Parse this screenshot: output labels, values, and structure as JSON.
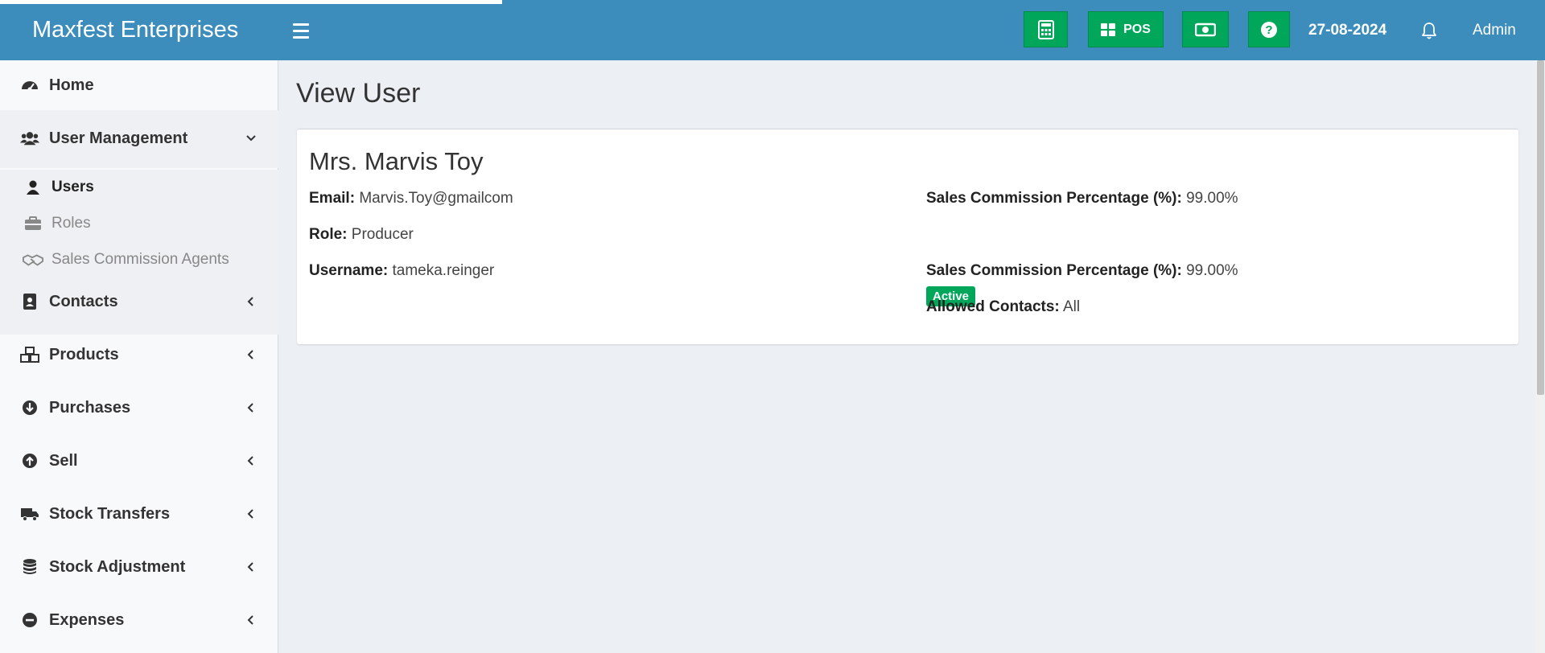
{
  "header": {
    "brand": "Maxfest Enterprises",
    "pos_label": "POS",
    "date": "27-08-2024",
    "user": "Admin",
    "icons": [
      "calculator-icon",
      "pos-grid-icon",
      "money-icon",
      "help-icon",
      "bell-icon"
    ],
    "accent": "#3c8dbc",
    "button_color": "#00a65a"
  },
  "sidebar": {
    "home": "Home",
    "user_management": "User Management",
    "users": "Users",
    "roles": "Roles",
    "sales_agents": "Sales Commission Agents",
    "contacts": "Contacts",
    "products": "Products",
    "purchases": "Purchases",
    "sell": "Sell",
    "stock_transfers": "Stock Transfers",
    "stock_adjustment": "Stock Adjustment",
    "expenses": "Expenses"
  },
  "main": {
    "page_title": "View User",
    "user": {
      "name": "Mrs. Marvis Toy",
      "email_label": "Email:",
      "email": "Marvis.Toy@gmailcom",
      "role_label": "Role:",
      "role": "Producer",
      "username_label": "Username:",
      "username": "tameka.reinger",
      "commission_label": "Sales Commission Percentage (%):",
      "commission": "99.00%",
      "status": "Active",
      "commission_label_2": "Sales Commission Percentage (%):",
      "commission_2": "99.00%",
      "allowed_contacts_label": "Allowed Contacts:",
      "allowed_contacts": "All"
    }
  }
}
